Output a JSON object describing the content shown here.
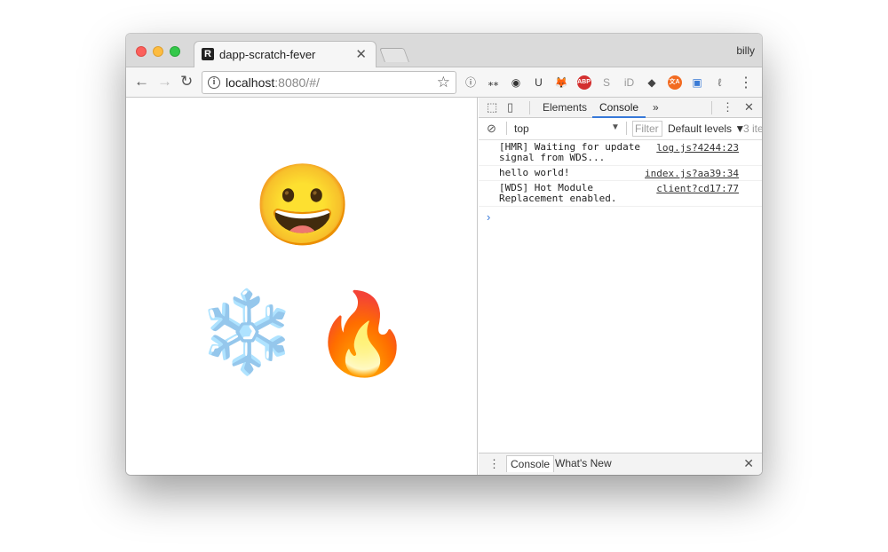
{
  "window": {
    "tab_title": "dapp-scratch-fever",
    "tab_favicon": "R",
    "tab_close": "✕",
    "profile_name": "billy"
  },
  "toolbar": {
    "back_icon": "←",
    "forward_icon": "→",
    "reload_icon": "↻",
    "url_host": "localhost",
    "url_rest": ":8080/#/",
    "star_icon": "☆",
    "menu_icon": "⋮",
    "extensions": [
      {
        "name": "info-icon",
        "glyph": "ⓘ",
        "color": "#444444"
      },
      {
        "name": "asterisk-icon",
        "glyph": "⁎⁎",
        "color": "#333333"
      },
      {
        "name": "pocket-icon",
        "glyph": "◉",
        "color": "#333333"
      },
      {
        "name": "shield-icon",
        "glyph": "U",
        "color": "#333333"
      },
      {
        "name": "metamask-icon",
        "glyph": "🦊",
        "color": "#e2761b"
      },
      {
        "name": "adblock-icon",
        "glyph": "ABP",
        "color": "#ffffff",
        "bg": "#d32f2f"
      },
      {
        "name": "skype-icon",
        "glyph": "S",
        "color": "#999999"
      },
      {
        "name": "id-icon",
        "glyph": "iD",
        "color": "#999999"
      },
      {
        "name": "evernote-icon",
        "glyph": "◆",
        "color": "#444444"
      },
      {
        "name": "translate-icon",
        "glyph": "文A",
        "color": "#ffffff",
        "bg": "#f26b21"
      },
      {
        "name": "notes-icon",
        "glyph": "▣",
        "color": "#3a7bd5"
      },
      {
        "name": "feather-icon",
        "glyph": "ℓ",
        "color": "#666666"
      }
    ]
  },
  "page": {
    "emoji_face": "😀",
    "emoji_snow": "❄️",
    "emoji_fire": "🔥"
  },
  "devtools": {
    "tabs": [
      "Elements",
      "Console"
    ],
    "active_tab": "Console",
    "more_tabs": "»",
    "context": "top",
    "filter_placeholder": "Filter",
    "levels": "Default levels ▼",
    "count": "3 ite",
    "messages": [
      {
        "text": "[HMR] Waiting for update signal from WDS...",
        "source": "log.js?4244:23"
      },
      {
        "text": "hello world!",
        "source": "index.js?aa39:34"
      },
      {
        "text": "[WDS] Hot Module Replacement enabled.",
        "source": "client?cd17:77"
      }
    ],
    "prompt": "›",
    "drawer_tabs": [
      "Console",
      "What's New"
    ],
    "drawer_close": "✕"
  }
}
